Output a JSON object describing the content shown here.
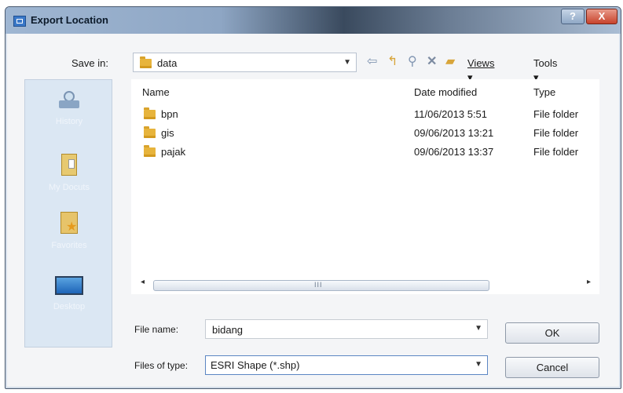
{
  "window": {
    "title": "Export Location",
    "help_glyph": "?",
    "close_glyph": "X"
  },
  "save_in": {
    "label": "Save in:",
    "value": "data"
  },
  "toolbar": {
    "back_icon": "back-arrow-icon",
    "up_icon": "up-folder-icon",
    "search_icon": "search-web-icon",
    "delete_icon": "delete-icon",
    "new_folder_icon": "new-folder-icon",
    "views_label": "Views",
    "tools_label": "Tools"
  },
  "places": [
    {
      "label": "History",
      "icon": "history-icon"
    },
    {
      "label": "My Docu­ts",
      "icon": "documents-icon"
    },
    {
      "label": "Favorites",
      "icon": "favorites-icon"
    },
    {
      "label": "Desktop",
      "icon": "desktop-icon"
    }
  ],
  "file_list": {
    "columns": {
      "name": "Name",
      "date": "Date modified",
      "type": "Type"
    },
    "rows": [
      {
        "name": "bpn",
        "date": "11/06/2013 5:51",
        "type": "File folder"
      },
      {
        "name": "gis",
        "date": "09/06/2013 13:21",
        "type": "File folder"
      },
      {
        "name": "pajak",
        "date": "09/06/2013 13:37",
        "type": "File folder"
      }
    ]
  },
  "scrollbar": {
    "grip": "III"
  },
  "file_name": {
    "label": "File name:",
    "value": "bidang"
  },
  "file_type": {
    "label": "Files of type:",
    "value": "ESRI Shape (*.shp)"
  },
  "buttons": {
    "ok": "OK",
    "cancel": "Cancel"
  },
  "colors": {
    "titlebar_accent": "#8ea6c4",
    "close_red": "#c8432c",
    "places_bg": "#dbe7f3"
  }
}
